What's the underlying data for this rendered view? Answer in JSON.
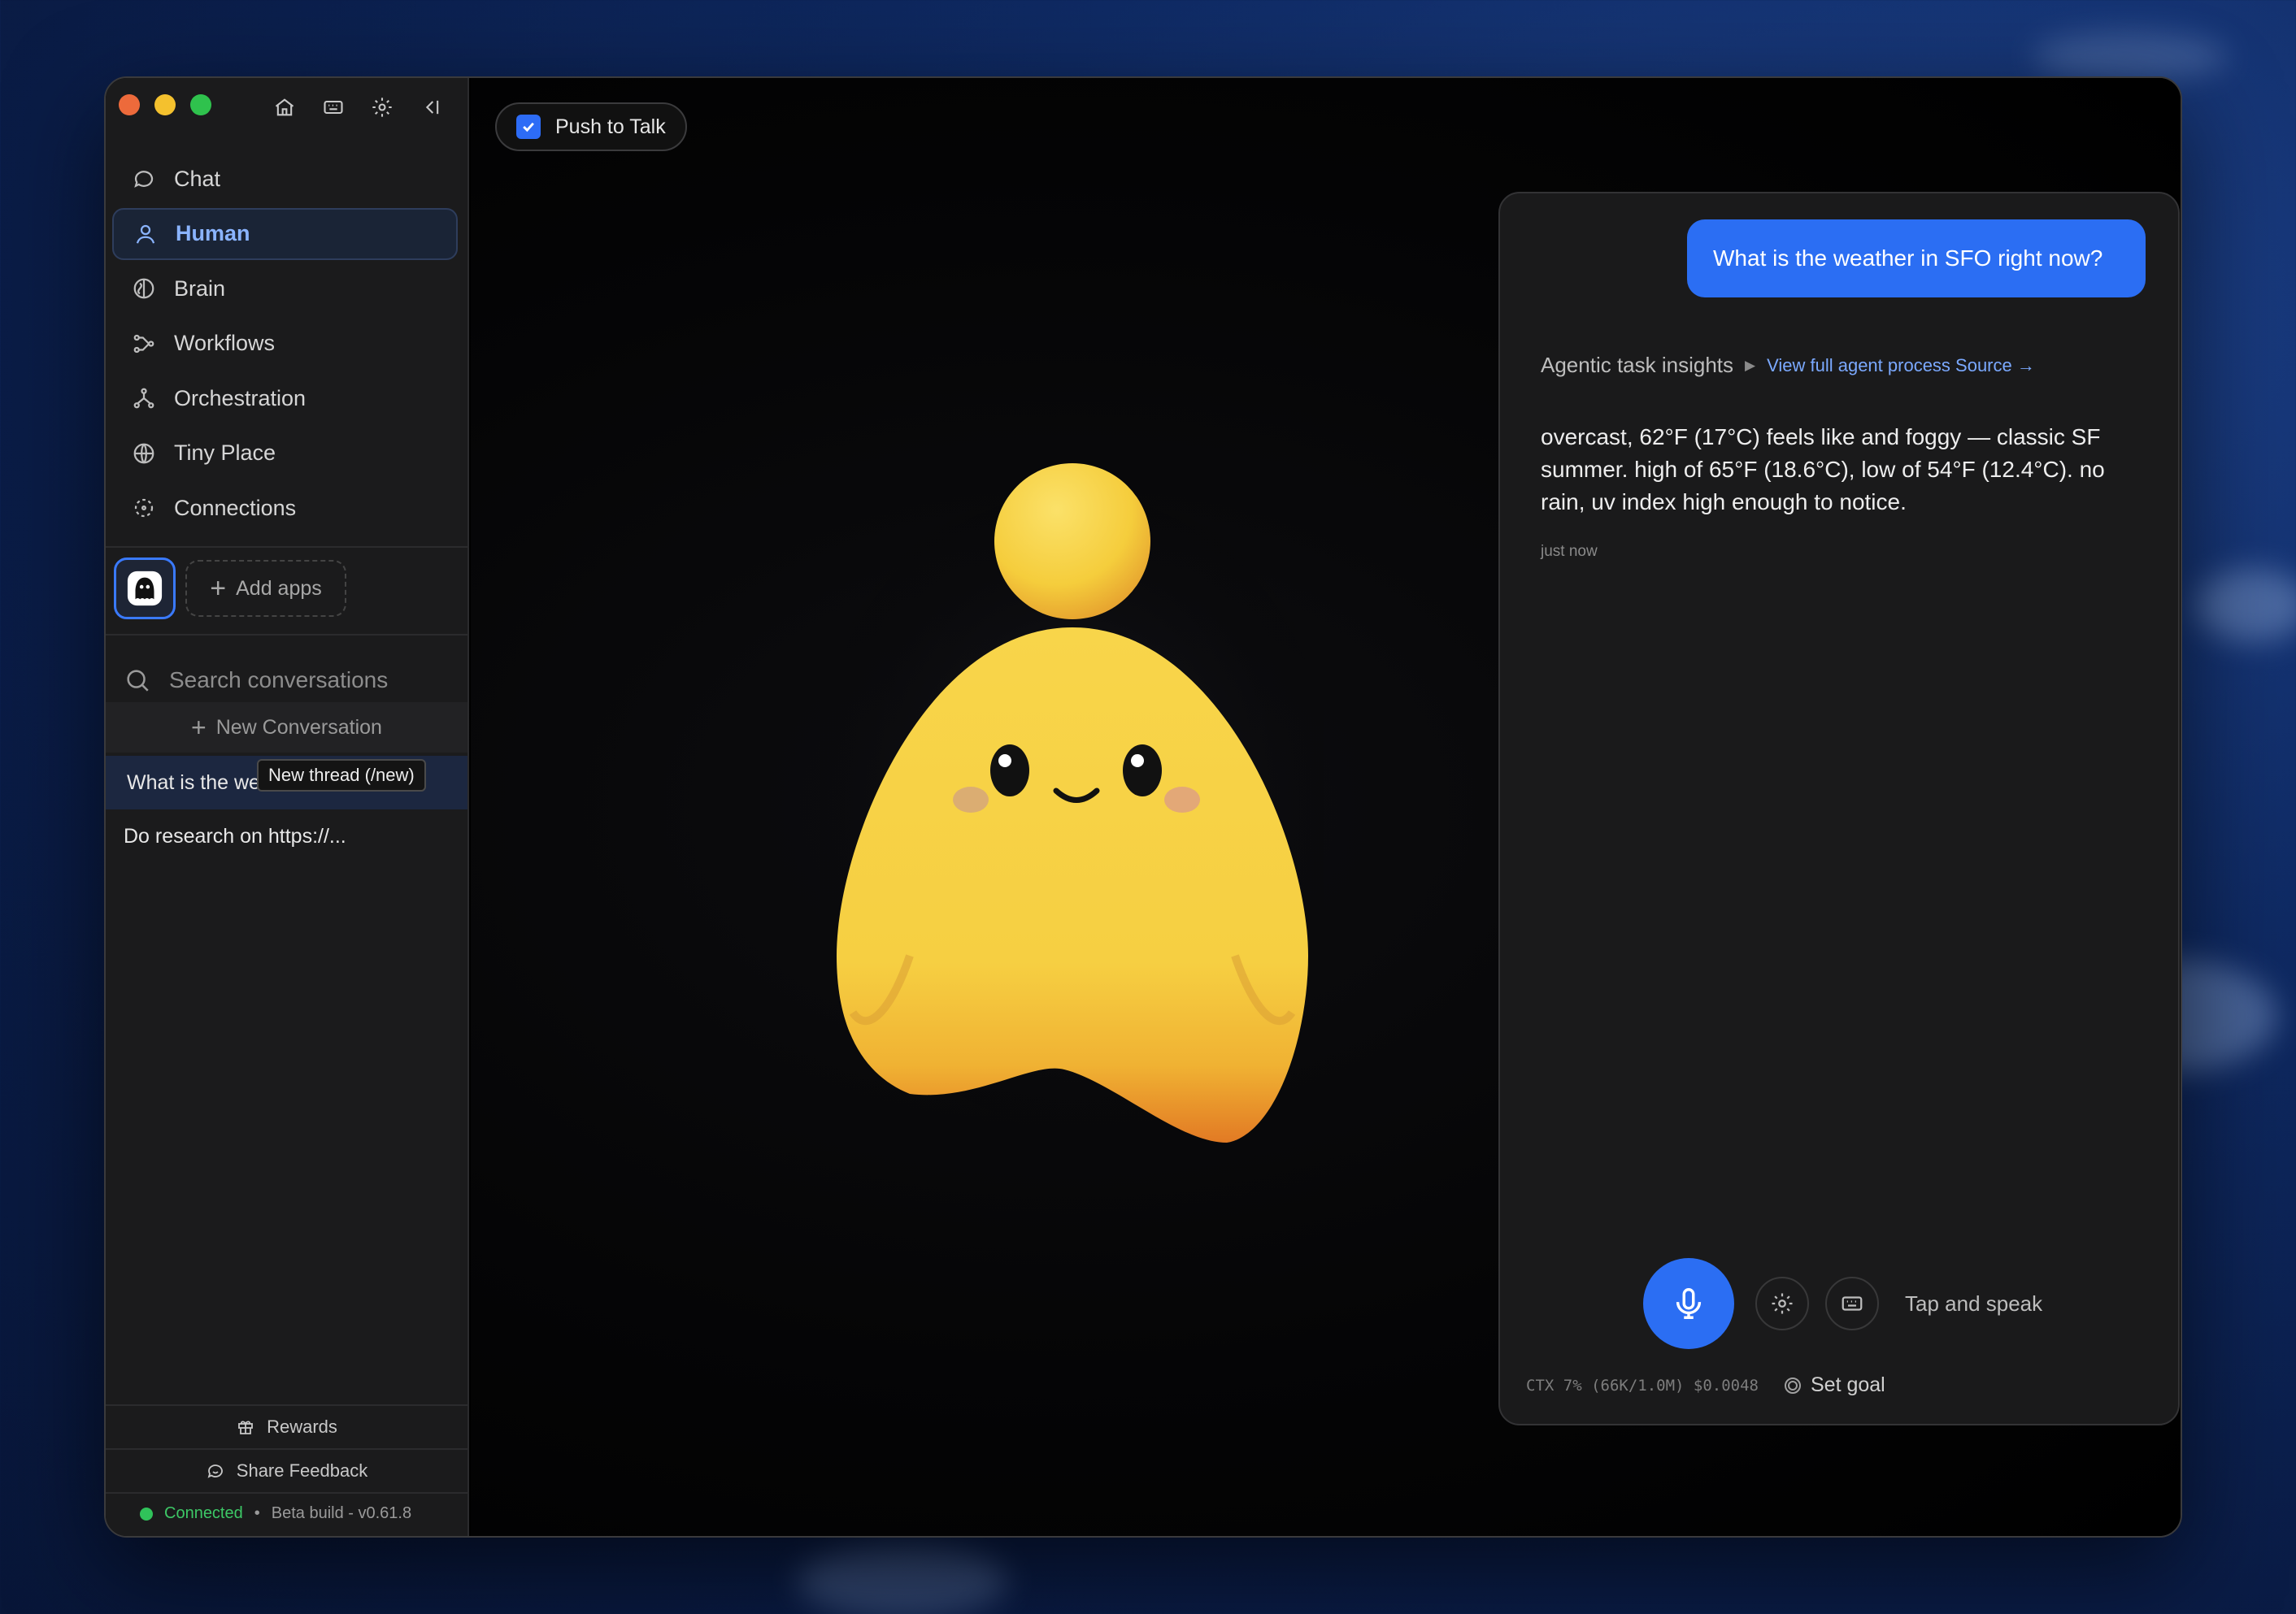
{
  "window": {
    "nav_items": [
      {
        "label": "Chat",
        "icon": "chat-bubble-icon"
      },
      {
        "label": "Human",
        "icon": "person-icon",
        "active": true
      },
      {
        "label": "Brain",
        "icon": "brain-icon"
      },
      {
        "label": "Workflows",
        "icon": "workflow-icon"
      },
      {
        "label": "Orchestration",
        "icon": "orchestration-icon"
      },
      {
        "label": "Tiny Place",
        "icon": "globe-icon"
      },
      {
        "label": "Connections",
        "icon": "connections-icon"
      }
    ],
    "top_icons": [
      "home-icon",
      "keyboard-icon",
      "gear-icon",
      "collapse-sidebar-icon"
    ],
    "add_apps_label": "Add apps",
    "search_placeholder": "Search conversations",
    "new_conversation_label": "New Conversation",
    "conversations": [
      {
        "title": "What is the weather in SFO right now?",
        "visible_text": "What is the we",
        "selected": true
      },
      {
        "title": "Do research on https://...",
        "selected": false
      }
    ],
    "tooltip": "New thread (/new)",
    "rewards_label": "Rewards",
    "feedback_label": "Share Feedback",
    "status": "Connected",
    "build": "Beta build - v0.61.8"
  },
  "main": {
    "push_to_talk_label": "Push to Talk",
    "push_to_talk_checked": true
  },
  "chat": {
    "user_message": "What is the weather in SFO right now?",
    "insights_label": "Agentic task insights",
    "insights_link": "View full agent process Source →",
    "assistant_message": "overcast, 62°F (17°C) feels like and foggy — classic SF summer. high of 65°F (18.6°C), low of 54°F (12.4°C). no rain, uv index high enough to notice.",
    "timestamp": "just now",
    "tap_label": "Tap and speak",
    "ctx": "CTX 7% (66K/1.0M) $0.0048",
    "goal_label": "Set goal"
  },
  "colors": {
    "accent": "#2b6ef3",
    "link": "#7ba9ff",
    "connected": "#3dc866",
    "mascot": "#f7d24a"
  }
}
